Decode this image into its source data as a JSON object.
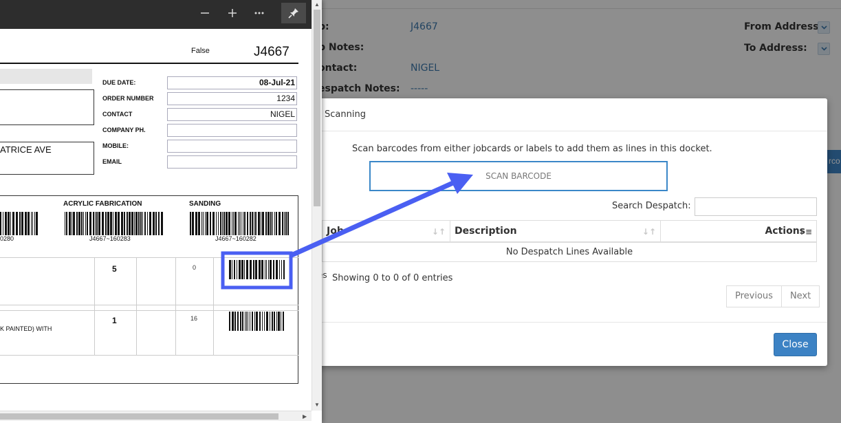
{
  "background": {
    "job_label": "b:",
    "job_value": "J4667",
    "job_notes_label": "b Notes:",
    "contact_label": "ontact:",
    "contact_value": "NIGEL",
    "despatch_notes_label": "espatch Notes:",
    "despatch_notes_value": "-----",
    "from_address_label": "From Address:",
    "to_address_label": "To Address:",
    "edge_button_text": "rco"
  },
  "modal": {
    "title": "Scanning",
    "instruction": "Scan barcodes from either jobcards or labels to add them as lines in this docket.",
    "scan_placeholder": "SCAN BARCODE",
    "search_label": "Search Despatch:",
    "search_value": "",
    "columns": [
      "Job",
      "Description",
      "Actions"
    ],
    "empty_message": "No Despatch Lines Available",
    "clipped_left_text": "es",
    "info": "Showing 0 to 0 of 0 entries",
    "prev_label": "Previous",
    "next_label": "Next",
    "close_label": "Close"
  },
  "pdf": {
    "toolbar_icons": [
      "minus-icon",
      "plus-icon",
      "more-icon",
      "pin-icon"
    ],
    "false_text": "False",
    "job_number": "J4667",
    "fields": [
      {
        "label": "DUE DATE:",
        "value": "08-Jul-21"
      },
      {
        "label": "ORDER NUMBER",
        "value": "1234"
      },
      {
        "label": "CONTACT",
        "value": "NIGEL"
      },
      {
        "label": "COMPANY PH.",
        "value": ""
      },
      {
        "label": "MOBILE:",
        "value": ""
      },
      {
        "label": "EMAIL",
        "value": ""
      }
    ],
    "address_fragment": "ATRICE AVE",
    "sections": [
      {
        "title": "",
        "caption": "0280"
      },
      {
        "title": "ACRYLIC FABRICATION",
        "caption": "J4667~160283"
      },
      {
        "title": "SANDING",
        "caption": "J4667~160282"
      }
    ],
    "rows": [
      {
        "qty": "5",
        "num": "0",
        "desc": ""
      },
      {
        "qty": "1",
        "num": "16",
        "desc": "K PAINTED) WITH"
      }
    ]
  }
}
